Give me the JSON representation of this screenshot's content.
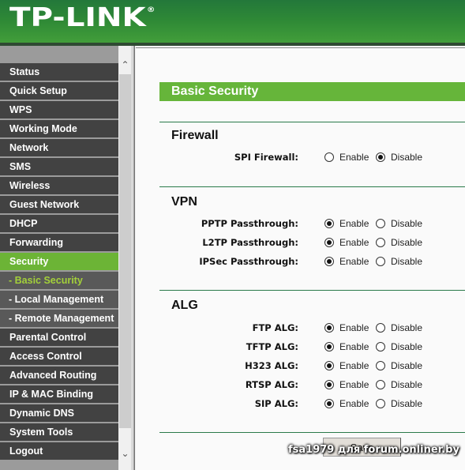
{
  "header": {
    "brand": "TP-LINK",
    "trademark": "®"
  },
  "sidebar": {
    "items": [
      {
        "label": "Status",
        "state": "normal"
      },
      {
        "label": "Quick Setup",
        "state": "normal"
      },
      {
        "label": "WPS",
        "state": "normal"
      },
      {
        "label": "Working Mode",
        "state": "normal"
      },
      {
        "label": "Network",
        "state": "normal"
      },
      {
        "label": "SMS",
        "state": "normal"
      },
      {
        "label": "Wireless",
        "state": "normal"
      },
      {
        "label": "Guest Network",
        "state": "normal"
      },
      {
        "label": "DHCP",
        "state": "normal"
      },
      {
        "label": "Forwarding",
        "state": "normal"
      },
      {
        "label": "Security",
        "state": "active"
      },
      {
        "label": "- Basic Security",
        "state": "sub-current"
      },
      {
        "label": "- Local Management",
        "state": "sub"
      },
      {
        "label": "- Remote Management",
        "state": "sub"
      },
      {
        "label": "Parental Control",
        "state": "normal"
      },
      {
        "label": "Access Control",
        "state": "normal"
      },
      {
        "label": "Advanced Routing",
        "state": "normal"
      },
      {
        "label": "IP & MAC Binding",
        "state": "normal"
      },
      {
        "label": "Dynamic DNS",
        "state": "normal"
      },
      {
        "label": "System Tools",
        "state": "normal"
      },
      {
        "label": "Logout",
        "state": "normal"
      }
    ]
  },
  "main": {
    "title": "Basic Security",
    "enable_label": "Enable",
    "disable_label": "Disable",
    "sections": [
      {
        "title": "Firewall",
        "rows": [
          {
            "label": "SPI Firewall:",
            "value": "Disable"
          }
        ]
      },
      {
        "title": "VPN",
        "rows": [
          {
            "label": "PPTP Passthrough:",
            "value": "Enable"
          },
          {
            "label": "L2TP Passthrough:",
            "value": "Enable"
          },
          {
            "label": "IPSec Passthrough:",
            "value": "Enable"
          }
        ]
      },
      {
        "title": "ALG",
        "rows": [
          {
            "label": "FTP ALG:",
            "value": "Enable"
          },
          {
            "label": "TFTP ALG:",
            "value": "Enable"
          },
          {
            "label": "H323 ALG:",
            "value": "Enable"
          },
          {
            "label": "RTSP ALG:",
            "value": "Enable"
          },
          {
            "label": "SIP ALG:",
            "value": "Enable"
          }
        ]
      }
    ],
    "save_label": "Save"
  },
  "watermark": "fsa1979 для forum.onliner.by",
  "colors": {
    "accent_green": "#6cb436",
    "header_green": "#2f8a36",
    "menu_dark": "#424242",
    "sub_current": "#a3d03a"
  }
}
